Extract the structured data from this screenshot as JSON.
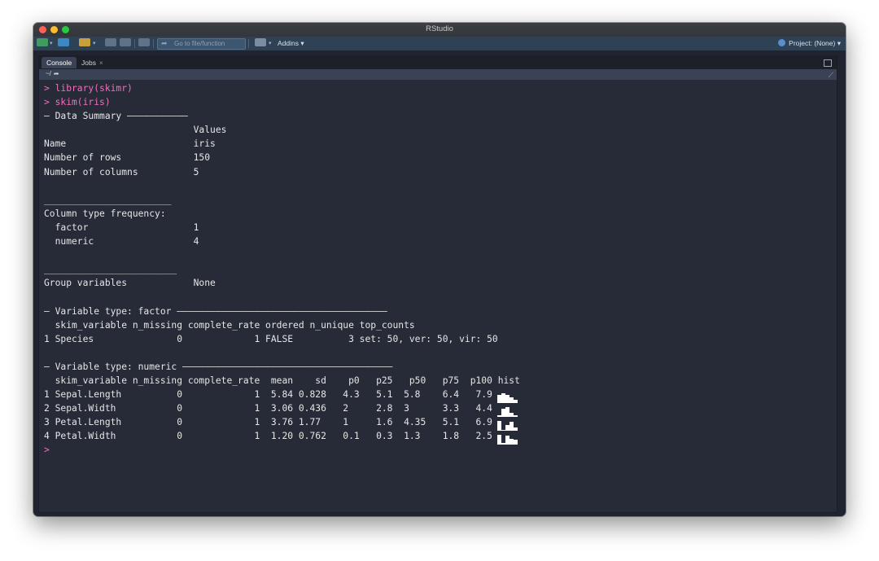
{
  "window": {
    "title": "RStudio"
  },
  "toolbar": {
    "goto_placeholder": "Go to file/function",
    "addins_label": "Addins",
    "project_label": "Project: (None)"
  },
  "tabs": [
    {
      "label": "Console",
      "active": true
    },
    {
      "label": "Jobs",
      "active": false,
      "close": "×"
    }
  ],
  "path": "~/",
  "console": {
    "commands": [
      "> library(skimr)",
      "> skim(iris)"
    ],
    "summary_header": "— Data Summary ———————————",
    "values_header": "                           Values",
    "summary_rows": [
      "Name                       iris",
      "Number of rows             150",
      "Number of columns          5"
    ],
    "divider1": "_______________________",
    "col_type_freq": "Column type frequency:",
    "freq_rows": [
      "  factor                   1",
      "  numeric                  4"
    ],
    "divider2": "________________________",
    "group_vars": "Group variables            None",
    "factor_header": "— Variable type: factor ——————————————————————————————————————",
    "factor_cols": "  skim_variable n_missing complete_rate ordered n_unique top_counts",
    "factor_rows": [
      "1 Species               0             1 FALSE          3 set: 50, ver: 50, vir: 50"
    ],
    "numeric_header": "— Variable type: numeric ——————————————————————————————————————",
    "numeric_cols": "  skim_variable n_missing complete_rate  mean    sd    p0   p25   p50   p75  p100 hist",
    "numeric_rows": [
      "1 Sepal.Length          0             1  5.84 0.828   4.3   5.1  5.8    6.4   7.9",
      "2 Sepal.Width           0             1  3.06 0.436   2     2.8  3      3.3   4.4",
      "3 Petal.Length          0             1  3.76 1.77    1     1.6  4.35   5.1   6.9",
      "4 Petal.Width           0             1  1.20 0.762   0.1   0.3  1.3    1.8   2.5"
    ],
    "hist_levels": [
      [
        0.85,
        1.0,
        0.8,
        0.55,
        0.35
      ],
      [
        0.15,
        0.8,
        1.0,
        0.4,
        0.2
      ],
      [
        1.0,
        0.1,
        0.55,
        0.95,
        0.3
      ],
      [
        1.0,
        0.15,
        0.9,
        0.6,
        0.5
      ]
    ],
    "final_prompt": ">"
  },
  "colors": {
    "command": "#f06fbe",
    "console_bg": "#272b38",
    "toolbar_bg": "#2e4155"
  }
}
